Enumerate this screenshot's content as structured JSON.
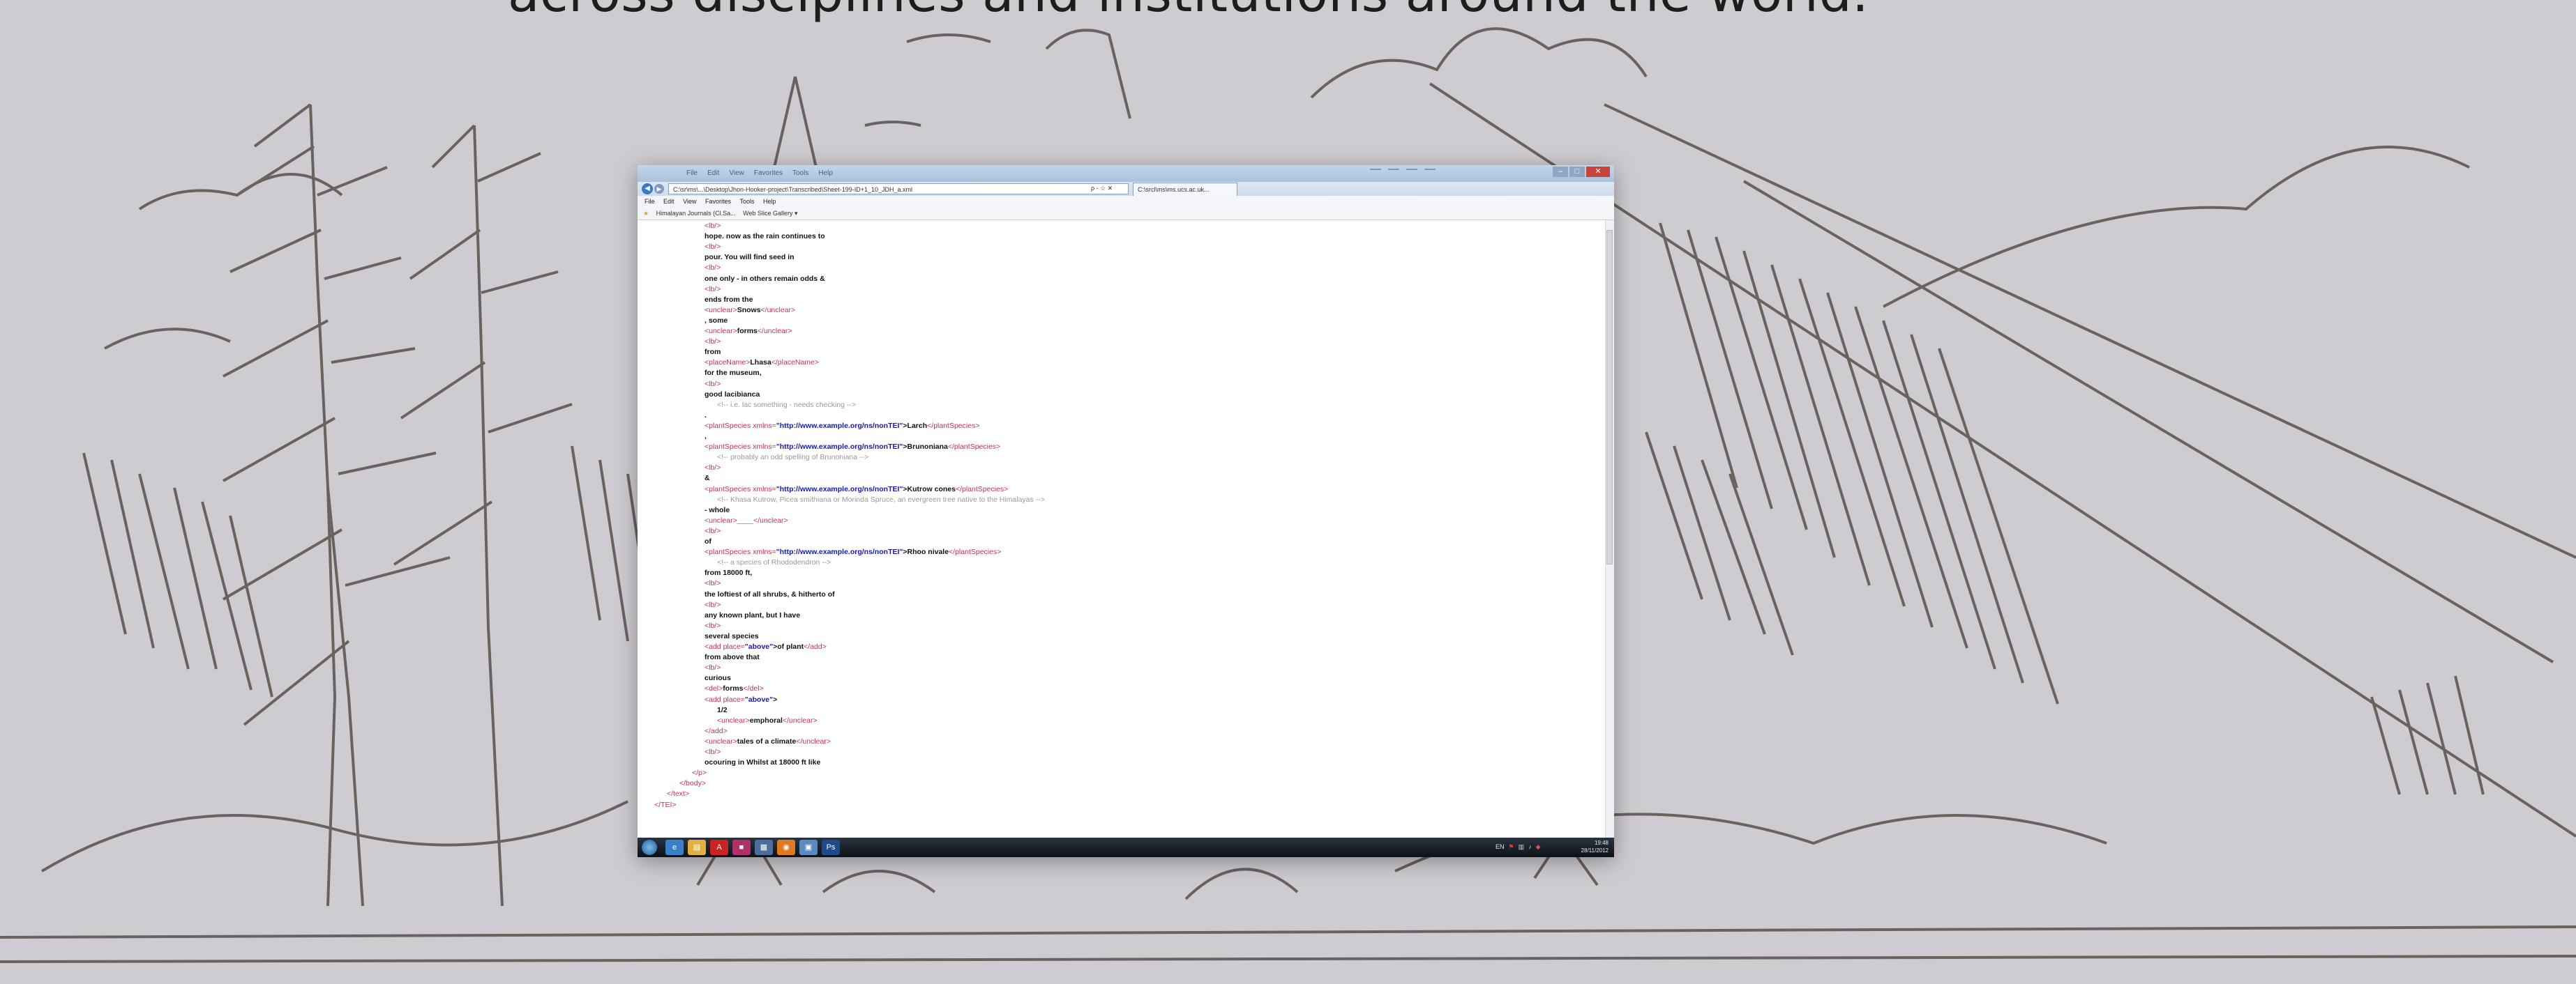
{
  "slide": {
    "caption_visible": "across disciplines and institutions around the world."
  },
  "browser": {
    "titlebar_menu": [
      "File",
      "Edit",
      "View",
      "Favorites",
      "Tools",
      "Help"
    ],
    "titlebar_buttons": [
      "",
      "",
      "",
      ""
    ],
    "address_url": "C:\\sr\\ms\\...\\Desktop\\Jhon-Hooker-project\\Transcribed\\Sheet-199-ID+1_10_JDH_a.xml",
    "address_controls": "ρ - ☆ ✕",
    "tab_label": "C:\\srcl\\ms\\ms.ucs.ac.uk...",
    "menubar": [
      "File",
      "Edit",
      "View",
      "Favorites",
      "Tools",
      "Help"
    ],
    "favbar": [
      "Himalayan Journals (Cl.Sa...",
      "Web Slice Gallery ▾"
    ]
  },
  "xml_lines": [
    {
      "k": "tag",
      "i": 0,
      "t": "<lb/>"
    },
    {
      "k": "text",
      "i": 0,
      "t": "hope. now as the rain continues to"
    },
    {
      "k": "tag",
      "i": 0,
      "t": "<lb/>"
    },
    {
      "k": "text",
      "i": 0,
      "t": "pour. You will find seed in"
    },
    {
      "k": "tag",
      "i": 0,
      "t": "<lb/>"
    },
    {
      "k": "text",
      "i": 0,
      "t": "one only - in others remain odds &"
    },
    {
      "k": "tag",
      "i": 0,
      "t": "<lb/>"
    },
    {
      "k": "text",
      "i": 0,
      "t": "ends from the"
    },
    {
      "k": "tag",
      "i": 0,
      "t": "<unclear>",
      "inner": "Snows",
      "close": "</unclear>"
    },
    {
      "k": "text",
      "i": 0,
      "t": ", some"
    },
    {
      "k": "tag",
      "i": 0,
      "t": "<unclear>",
      "inner": "forms",
      "close": "</unclear>"
    },
    {
      "k": "tag",
      "i": 0,
      "t": "<lb/>"
    },
    {
      "k": "text",
      "i": 0,
      "t": "from"
    },
    {
      "k": "tag",
      "i": 0,
      "t": "<placeName>",
      "inner": "Lhasa",
      "close": "</placeName>"
    },
    {
      "k": "text",
      "i": 0,
      "t": "for the museum,"
    },
    {
      "k": "tag",
      "i": 0,
      "t": "<lb/>"
    },
    {
      "k": "text",
      "i": 0,
      "t": "good lacibianca"
    },
    {
      "k": "comment",
      "i": 1,
      "t": "<!-- i.e. lac something - needs checking -->"
    },
    {
      "k": "text",
      "i": 0,
      "t": "."
    },
    {
      "k": "tag",
      "i": 0,
      "t": "<plantSpecies xmlns=",
      "val": "\"http://www.example.org/ns/nonTEI\"",
      "inner": ">Larch",
      "close": "</plantSpecies>"
    },
    {
      "k": "text",
      "i": 0,
      "t": ","
    },
    {
      "k": "tag",
      "i": 0,
      "t": "<plantSpecies xmlns=",
      "val": "\"http://www.example.org/ns/nonTEI\"",
      "inner": ">Brunoniana",
      "close": "</plantSpecies>"
    },
    {
      "k": "comment",
      "i": 1,
      "t": "<!-- probably an odd spelling of Brunoniana -->"
    },
    {
      "k": "tag",
      "i": 0,
      "t": "<lb/>"
    },
    {
      "k": "text",
      "i": 0,
      "t": "&"
    },
    {
      "k": "tag",
      "i": 0,
      "t": "<plantSpecies xmlns=",
      "val": "\"http://www.example.org/ns/nonTEI\"",
      "inner": ">Kutrow cones",
      "close": "</plantSpecies>"
    },
    {
      "k": "comment",
      "i": 1,
      "t": "<!-- Khasa Kutrow, Picea smithiana or Morinda Spruce, an evergreen tree native to the Himalayas -->"
    },
    {
      "k": "text",
      "i": 0,
      "t": "- whole"
    },
    {
      "k": "tag",
      "i": 0,
      "t": "<unclear>",
      "inner": "____",
      "close": "</unclear>"
    },
    {
      "k": "tag",
      "i": 0,
      "t": "<lb/>"
    },
    {
      "k": "text",
      "i": 0,
      "t": "of"
    },
    {
      "k": "tag",
      "i": 0,
      "t": "<plantSpecies xmlns=",
      "val": "\"http://www.example.org/ns/nonTEI\"",
      "inner": ">Rhoo nivale",
      "close": "</plantSpecies>"
    },
    {
      "k": "comment",
      "i": 1,
      "t": "<!-- a species of Rhododendron -->"
    },
    {
      "k": "text",
      "i": 0,
      "t": "from 18000 ft,"
    },
    {
      "k": "tag",
      "i": 0,
      "t": "<lb/>"
    },
    {
      "k": "text",
      "i": 0,
      "t": "the loftiest of all shrubs, & hitherto of"
    },
    {
      "k": "tag",
      "i": 0,
      "t": "<lb/>"
    },
    {
      "k": "text",
      "i": 0,
      "t": "any known plant, but I have"
    },
    {
      "k": "tag",
      "i": 0,
      "t": "<lb/>"
    },
    {
      "k": "text",
      "i": 0,
      "t": "several species"
    },
    {
      "k": "tag",
      "i": 0,
      "t": "<add place=",
      "val": "\"above\"",
      "inner": ">of plant",
      "close": "</add>"
    },
    {
      "k": "text",
      "i": 0,
      "t": "from above that"
    },
    {
      "k": "tag",
      "i": 0,
      "t": "<lb/>"
    },
    {
      "k": "text",
      "i": 0,
      "t": "curious"
    },
    {
      "k": "tag",
      "i": 0,
      "t": "<del>",
      "inner": "forms",
      "close": "</del>"
    },
    {
      "k": "tag",
      "i": 0,
      "t": "<add place=",
      "val": "\"above\"",
      "inner": ">",
      "close": ""
    },
    {
      "k": "text",
      "i": 1,
      "t": "1/2"
    },
    {
      "k": "tag",
      "i": 1,
      "t": "<unclear>",
      "inner": "emphoral",
      "close": "</unclear>"
    },
    {
      "k": "tag",
      "i": 0,
      "t": "</add>"
    },
    {
      "k": "tag",
      "i": 0,
      "t": "<unclear>",
      "inner": "tales of a climate",
      "close": "</unclear>"
    },
    {
      "k": "tag",
      "i": 0,
      "t": "<lb/>"
    },
    {
      "k": "text",
      "i": 0,
      "t": "ocouring in Whilst at 18000 ft like"
    },
    {
      "k": "tag",
      "i": -1,
      "t": "</p>"
    },
    {
      "k": "tag",
      "i": -2,
      "t": "</body>"
    },
    {
      "k": "tag",
      "i": -3,
      "t": "</text>"
    },
    {
      "k": "tag",
      "i": -4,
      "t": "</TEI>"
    }
  ],
  "taskbar": {
    "icons": [
      "internet-explorer-icon",
      "folder-icon",
      "acrobat-icon",
      "app-icon",
      "network-icon",
      "firefox-icon",
      "files-icon",
      "photoshop-icon"
    ],
    "clock_time": "19:48",
    "clock_date": "28/11/2012",
    "tray_text": "EN"
  }
}
